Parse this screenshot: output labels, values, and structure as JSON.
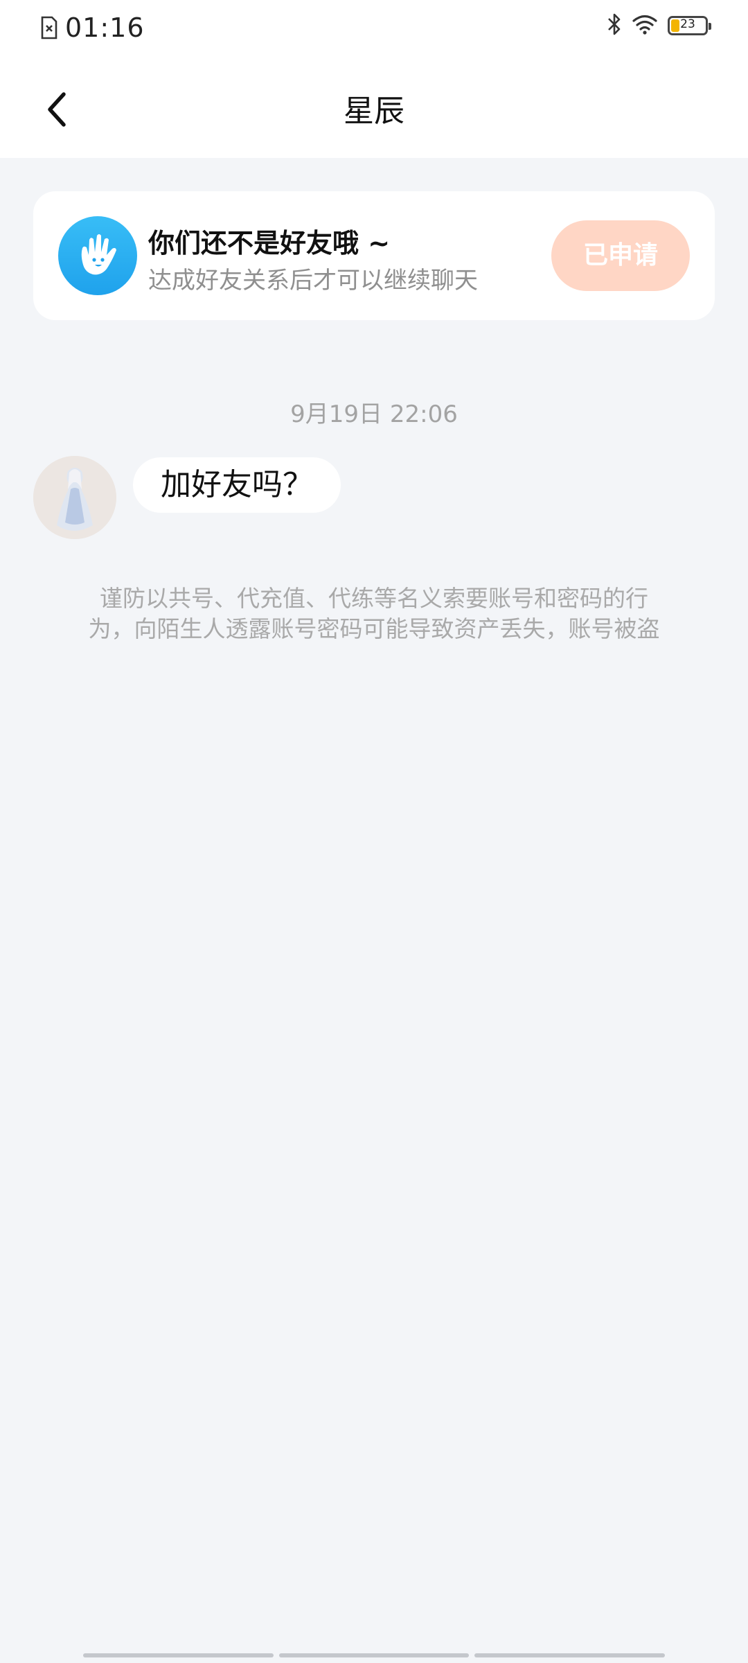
{
  "status_bar": {
    "time": "01:16",
    "battery_level": "23",
    "battery_fraction": 0.23,
    "icons": [
      "sim-error-icon",
      "bluetooth-icon",
      "wifi-icon",
      "battery-icon"
    ]
  },
  "header": {
    "title": "星辰",
    "back_icon": "chevron-left-icon"
  },
  "friend_notice": {
    "title": "你们还不是好友哦 ~",
    "subtitle": "达成好友关系后才可以继续聊天",
    "button_label": "已申请",
    "avatar_icon": "hand-icon",
    "avatar_color": "#29aaf0",
    "button_color": "#ffd6c5"
  },
  "chat": {
    "timestamp": "9月19日 22:06",
    "messages": [
      {
        "text": "加好友吗？",
        "from": "other"
      }
    ]
  },
  "warning": {
    "line1": "谨防以共号、代充值、代练等名义索要账号和密码的行",
    "line2": "为，向陌生人透露账号密码可能导致资产丢失，账号被盗"
  },
  "colors": {
    "background": "#f3f5f8",
    "header": "#ffffff"
  }
}
